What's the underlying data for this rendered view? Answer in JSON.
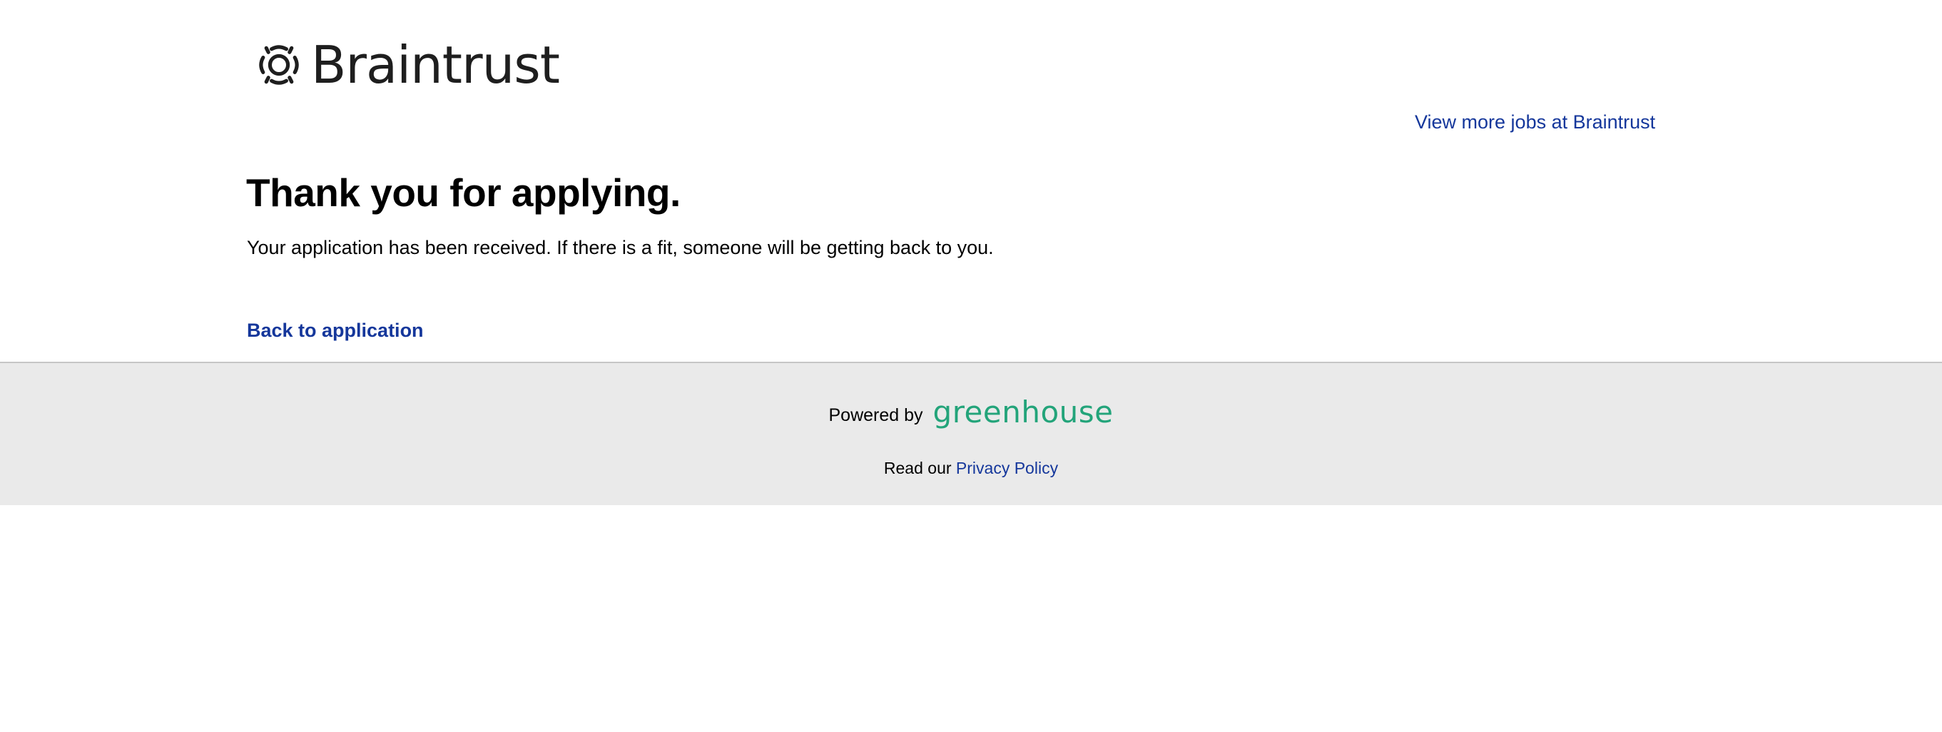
{
  "header": {
    "company_name": "Braintrust",
    "jobs_link": "View more jobs at Braintrust"
  },
  "main": {
    "title": "Thank you for applying.",
    "message": "Your application has been received. If there is a fit, someone will be getting back to you.",
    "back_link": "Back to application"
  },
  "footer": {
    "powered_by": "Powered by",
    "brand": "greenhouse",
    "read_our": "Read our",
    "privacy_link": "Privacy Policy"
  },
  "colors": {
    "link": "#15379b",
    "footer_bg": "#eaeaea",
    "greenhouse_green": "#23a47a"
  },
  "icons": [
    "braintrust-logo-icon"
  ]
}
